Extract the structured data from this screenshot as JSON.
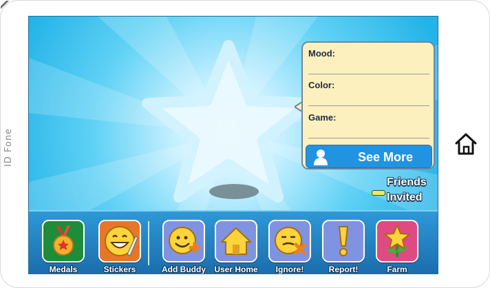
{
  "device": {
    "brand": "ID Fone"
  },
  "profile_card": {
    "fields": [
      {
        "label": "Mood:"
      },
      {
        "label": "Color:"
      },
      {
        "label": "Game:"
      }
    ],
    "see_more_label": "See More"
  },
  "friends_status": {
    "line1": "Friends",
    "line2": "Invited"
  },
  "toolbar": {
    "items": [
      {
        "label": "Medals",
        "icon": "medal-icon",
        "color": "#1f8c3a"
      },
      {
        "label": "Stickers",
        "icon": "smiley-sticker-icon",
        "color": "#e8762a"
      },
      {
        "label": "Add Buddy",
        "icon": "add-buddy-icon",
        "color": "#7f93e0"
      },
      {
        "label": "User Home",
        "icon": "house-icon",
        "color": "#7f93e0"
      },
      {
        "label": "Ignore!",
        "icon": "ignore-icon",
        "color": "#7f93e0"
      },
      {
        "label": "Report!",
        "icon": "exclamation-icon",
        "color": "#7f93e0"
      },
      {
        "label": "Farm",
        "icon": "flower-icon",
        "color": "#e04a82"
      }
    ]
  },
  "colors": {
    "screen_bg": "#39c1ee",
    "card_bg": "#fdf0bf",
    "see_more_bg": "#2293e0"
  }
}
